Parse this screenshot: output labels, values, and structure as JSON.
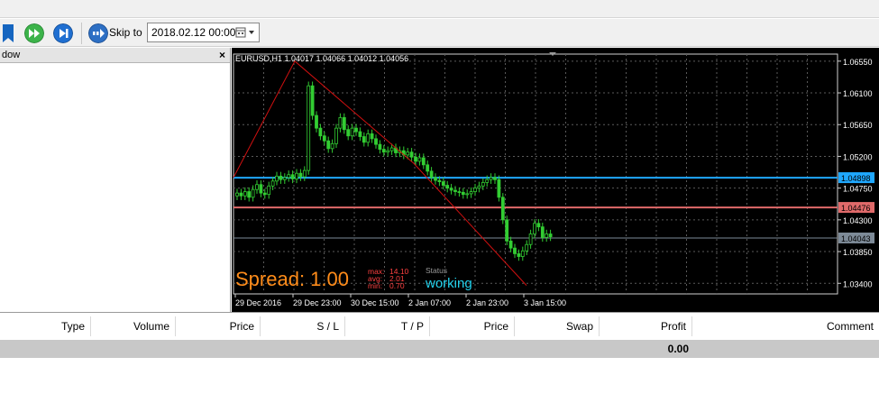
{
  "toolbar": {
    "skip_label": "Skip to",
    "skip_date": "2018.02.12 00:00",
    "icons": [
      "bookmark-icon",
      "fast-forward-icon",
      "skip-end-icon",
      "skip-to-icon",
      "calendar-icon"
    ]
  },
  "left_panel": {
    "title": "dow",
    "close": "×"
  },
  "chart": {
    "header": "EURUSD,H1  1.04017 1.04066 1.04012 1.04056",
    "spread_label": "Spread: 1.00",
    "stats": [
      {
        "label": "max:",
        "value": "14.10"
      },
      {
        "label": "avg:",
        "value": "2.01"
      },
      {
        "label": "min:",
        "value": "0.70"
      }
    ],
    "status_label": "Status",
    "status_value": "working",
    "colors": {
      "background": "#000000",
      "grid": "#5a5a5a",
      "candles": "#32cd32",
      "zigzag": "#d01010",
      "blue_line": "#1fa8ff",
      "red_line": "#e06a6a",
      "spread": "#ff8c1a",
      "stats": "#ff4040",
      "status": "#22d3ee"
    }
  },
  "chart_data": {
    "type": "candlestick",
    "symbol": "EURUSD,H1",
    "ohlc_last": {
      "open": 1.04017,
      "high": 1.04066,
      "low": 1.04012,
      "close": 1.04056
    },
    "y_ticks": [
      "1.06550",
      "1.06100",
      "1.05650",
      "1.05200",
      "1.04750",
      "1.04300",
      "1.03850",
      "1.03400"
    ],
    "ylim": [
      1.0325,
      1.0665
    ],
    "x_ticks": [
      "29 Dec 2016",
      "29 Dec 23:00",
      "30 Dec 15:00",
      "2 Jan 07:00",
      "2 Jan 23:00",
      "3 Jan 15:00"
    ],
    "price_labels": [
      {
        "value": "1.04898",
        "color": "#1fa8ff"
      },
      {
        "value": "1.04476",
        "color": "#e06a6a"
      },
      {
        "value": "1.04043",
        "color": "#7d8a97"
      }
    ],
    "horizontal_lines": [
      1.04898,
      1.04476,
      1.04043
    ],
    "zigzag": [
      [
        0,
        1.049
      ],
      [
        68,
        1.0655
      ],
      [
        200,
        1.051
      ],
      [
        325,
        1.0337
      ]
    ],
    "closes": [
      1.0468,
      1.0464,
      1.047,
      1.0462,
      1.0473,
      1.048,
      1.0468,
      1.0466,
      1.0478,
      1.0485,
      1.0492,
      1.0487,
      1.049,
      1.0494,
      1.0488,
      1.0496,
      1.0491,
      1.05,
      1.062,
      1.0578,
      1.056,
      1.0549,
      1.0542,
      1.0531,
      1.0538,
      1.056,
      1.0575,
      1.0558,
      1.0549,
      1.056,
      1.0555,
      1.0548,
      1.054,
      1.0552,
      1.0545,
      1.0537,
      1.053,
      1.0526,
      1.0528,
      1.0532,
      1.0525,
      1.0528,
      1.0522,
      1.0526,
      1.0519,
      1.0513,
      1.0518,
      1.0508,
      1.0499,
      1.049,
      1.0486,
      1.0484,
      1.0479,
      1.0475,
      1.0472,
      1.047,
      1.0469,
      1.0466,
      1.0467,
      1.047,
      1.0475,
      1.0478,
      1.0483,
      1.0487,
      1.049,
      1.0487,
      1.0462,
      1.043,
      1.04,
      1.039,
      1.0382,
      1.0378,
      1.0386,
      1.0395,
      1.041,
      1.0425,
      1.042,
      1.0405,
      1.041,
      1.0406
    ]
  },
  "terminal": {
    "columns": [
      "Type",
      "Volume",
      "Price",
      "S / L",
      "T / P",
      "Price",
      "Swap",
      "Profit",
      "Comment"
    ],
    "total_profit": "0.00"
  }
}
